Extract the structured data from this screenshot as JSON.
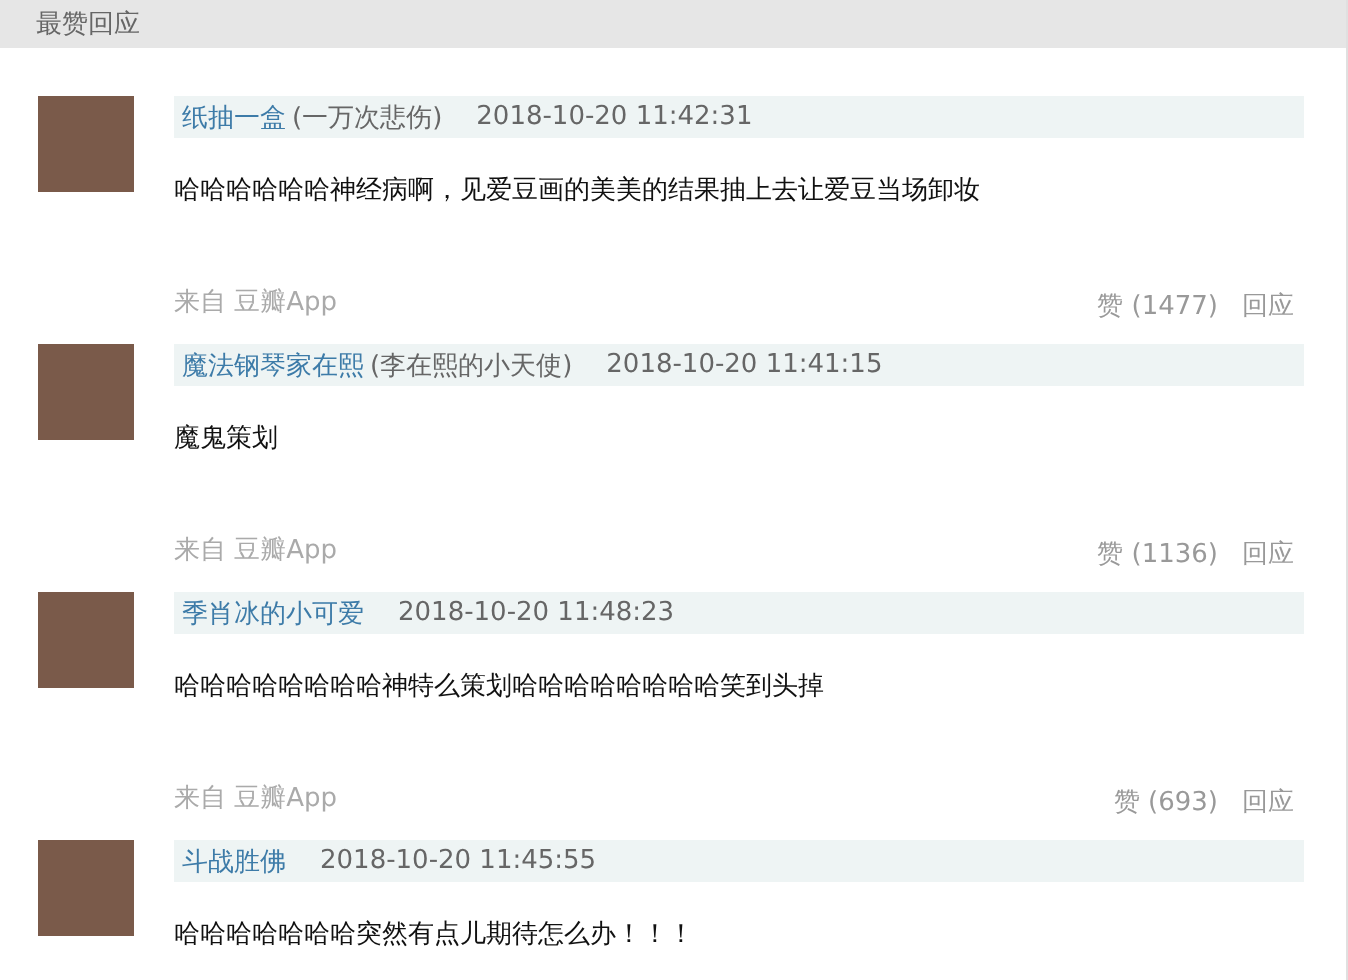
{
  "section_title": "最赞回应",
  "comments": [
    {
      "author": "纸抽一盒",
      "nickname": "(一万次悲伤)",
      "time": "2018-10-20 11:42:31",
      "text": "哈哈哈哈哈哈神经病啊，见爱豆画的美美的结果抽上去让爱豆当场卸妆",
      "source": "来自 豆瓣App",
      "likes": "赞 (1477)",
      "reply": "回应"
    },
    {
      "author": "魔法钢琴家在熙",
      "nickname": "(李在熙的小天使)",
      "time": "2018-10-20 11:41:15",
      "text": "魔鬼策划",
      "source": "来自 豆瓣App",
      "likes": "赞 (1136)",
      "reply": "回应"
    },
    {
      "author": "季肖冰的小可爱",
      "time": "2018-10-20 11:48:23",
      "text": "哈哈哈哈哈哈哈哈神特么策划哈哈哈哈哈哈哈哈笑到头掉",
      "source": "来自 豆瓣App",
      "likes": "赞 (693)",
      "reply": "回应"
    },
    {
      "author": "斗战胜佛",
      "time": "2018-10-20 11:45:55",
      "text": "哈哈哈哈哈哈哈突然有点儿期待怎么办！！！"
    }
  ]
}
